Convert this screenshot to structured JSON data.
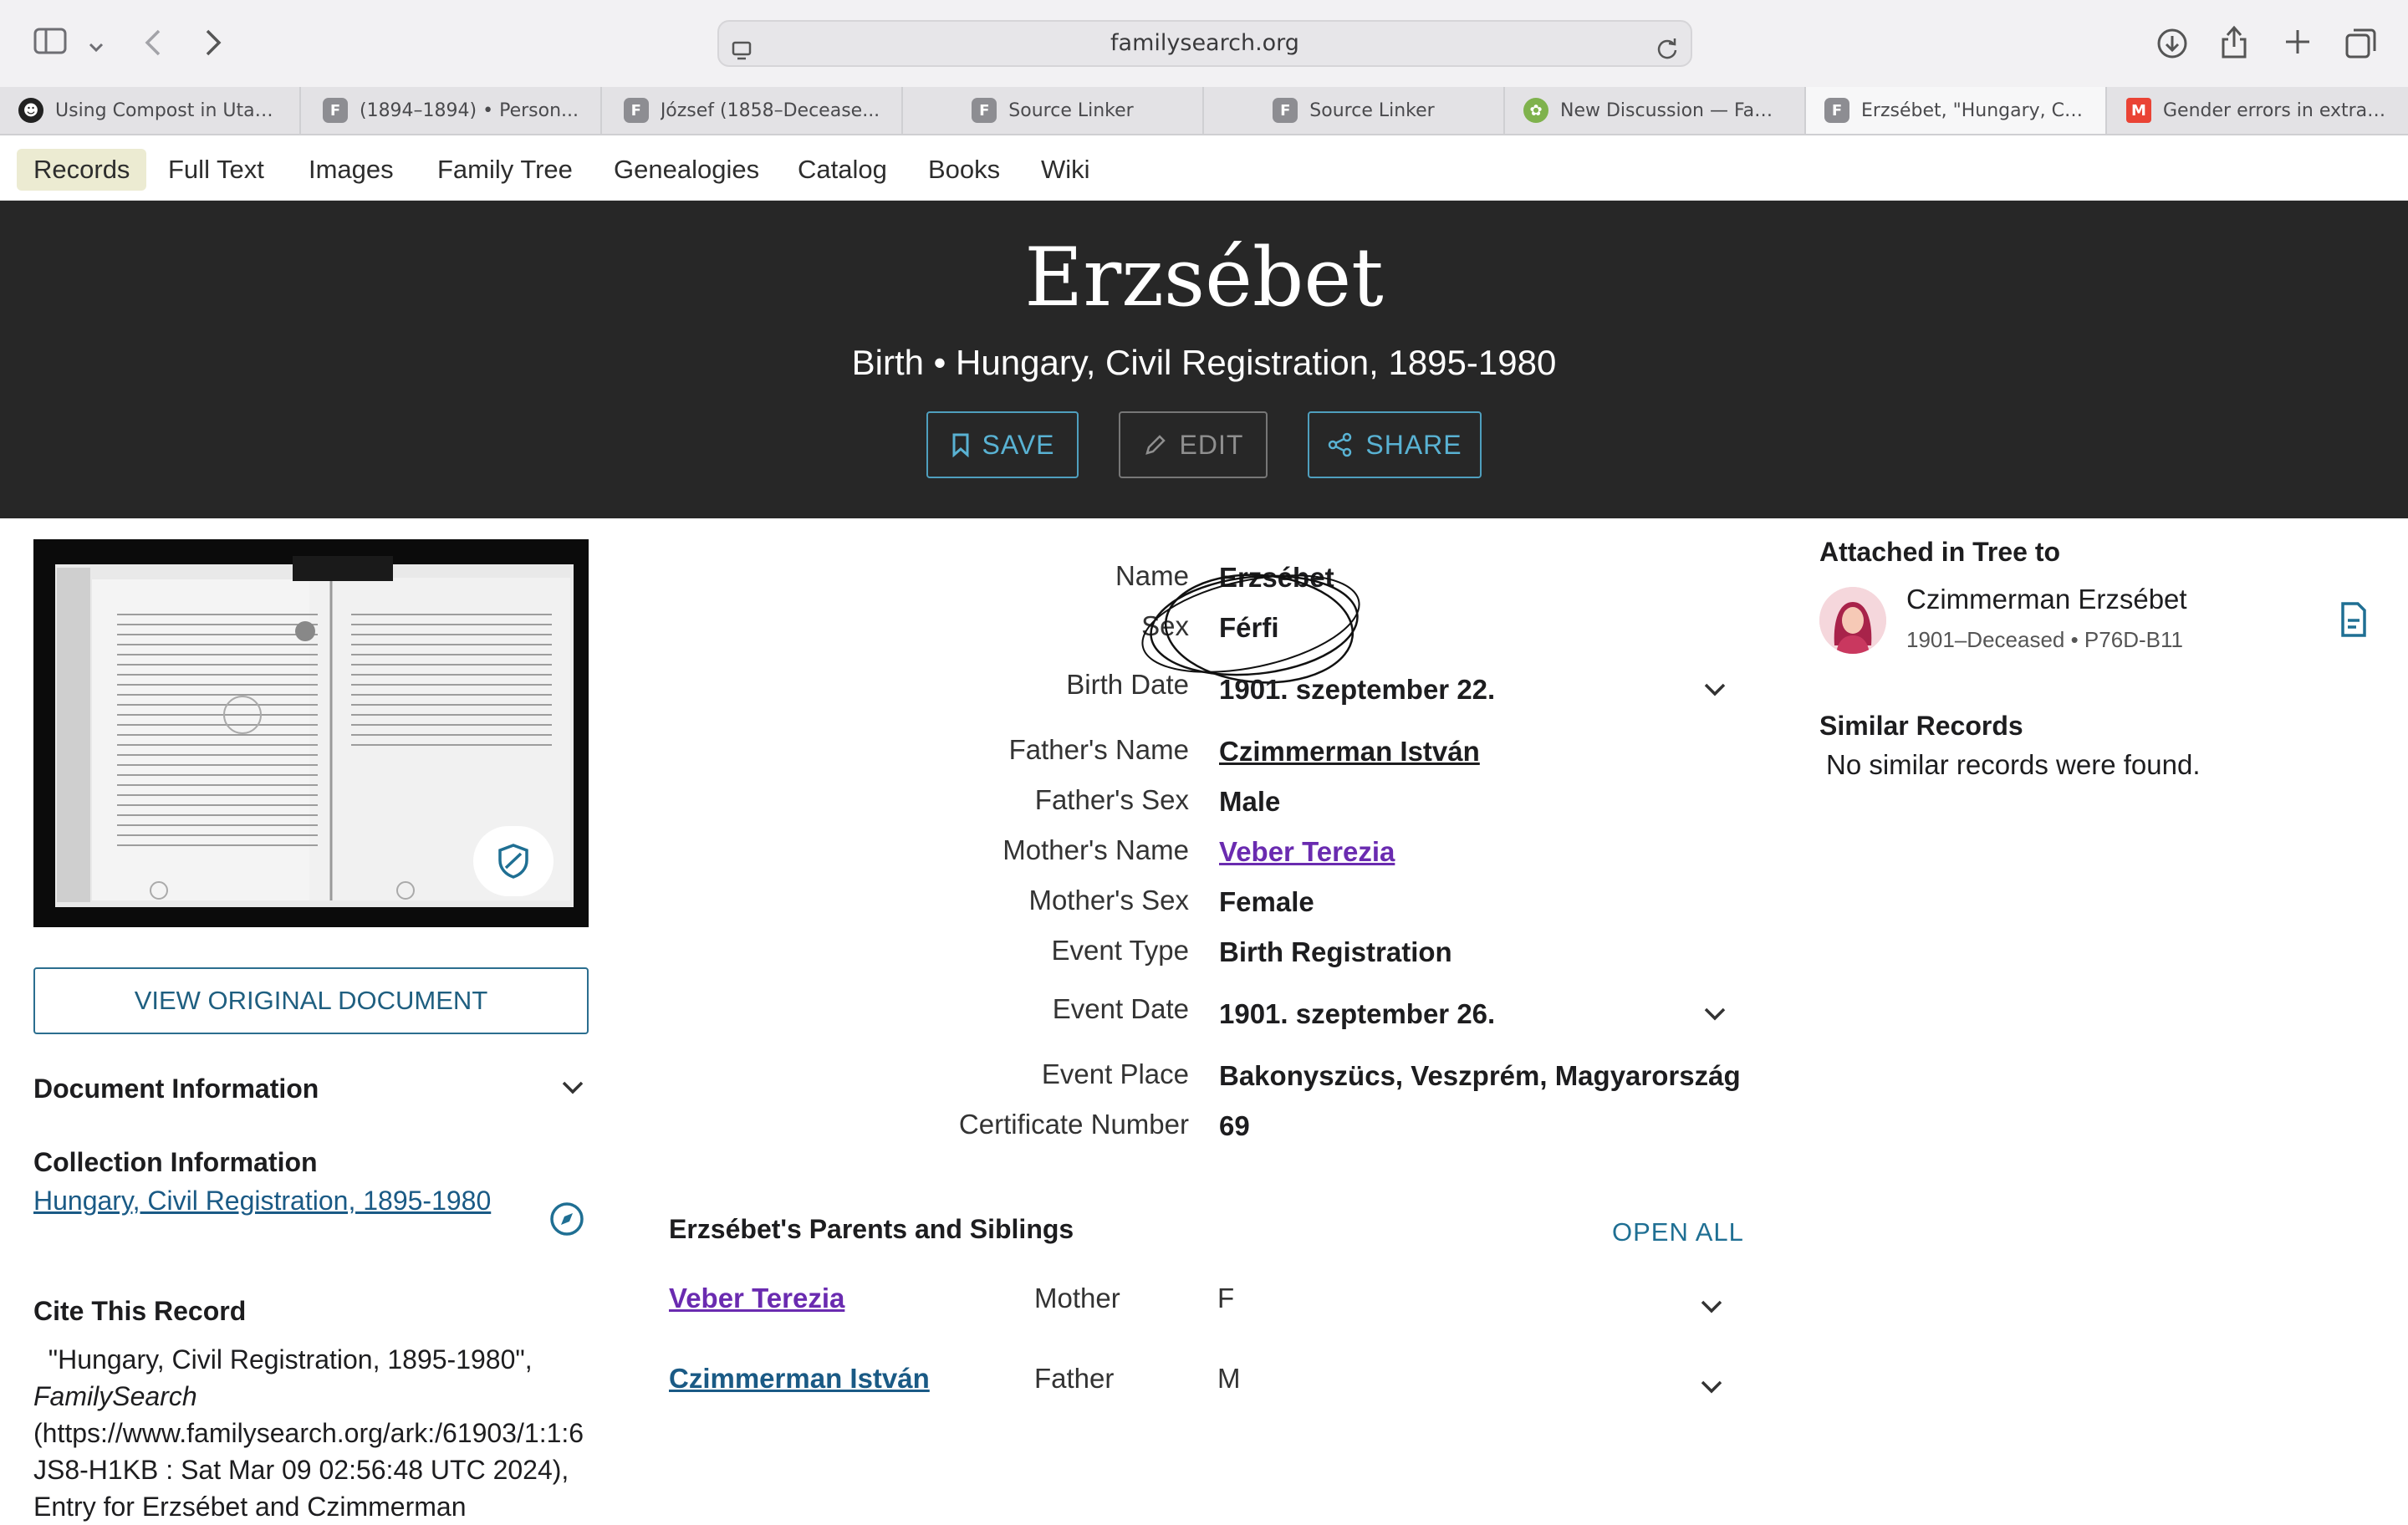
{
  "browser": {
    "url": "familysearch.org",
    "tabs": [
      {
        "label": "Using Compost in Utah...",
        "icon": "compost-favicon"
      },
      {
        "label": "(1894–1894) • Person...",
        "icon": "familysearch-favicon"
      },
      {
        "label": "József (1858–Decease...",
        "icon": "familysearch-favicon"
      },
      {
        "label": "Source Linker",
        "icon": "familysearch-favicon"
      },
      {
        "label": "Source Linker",
        "icon": "familysearch-favicon"
      },
      {
        "label": "New Discussion — Fam...",
        "icon": "tree-favicon"
      },
      {
        "label": "Erzsébet, \"Hungary, Ci...",
        "icon": "familysearch-favicon"
      },
      {
        "label": "Gender errors in extrac...",
        "icon": "gmail-favicon"
      }
    ]
  },
  "site_nav": [
    "Records",
    "Full Text",
    "Images",
    "Family Tree",
    "Genealogies",
    "Catalog",
    "Books",
    "Wiki"
  ],
  "hero": {
    "title": "Erzsébet",
    "subtitle": "Birth • Hungary, Civil Registration, 1895-1980",
    "save_label": "SAVE",
    "edit_label": "EDIT",
    "share_label": "SHARE"
  },
  "left": {
    "view_original": "VIEW ORIGINAL DOCUMENT",
    "doc_info_heading": "Document Information",
    "collection_heading": "Collection Information",
    "collection_link": "Hungary, Civil Registration, 1895-1980",
    "cite_heading": "Cite This Record",
    "cite_pre": "\"Hungary, Civil Registration, 1895-1980\",",
    "cite_italic": "FamilySearch",
    "cite_post": "(https://www.familysearch.org/ark:/61903/1:1:6JS8-H1KB : Sat Mar 09 02:56:48 UTC 2024), Entry for Erzsébet and Czimmerman"
  },
  "fields": [
    {
      "label": "Name",
      "value": "Erzsébet"
    },
    {
      "label": "Sex",
      "value": "Férfi"
    },
    {
      "label": "Birth Date",
      "value": "1901. szeptember 22."
    },
    {
      "label": "Father's Name",
      "value": "Czimmerman István"
    },
    {
      "label": "Father's Sex",
      "value": "Male"
    },
    {
      "label": "Mother's Name",
      "value": "Veber Terezia"
    },
    {
      "label": "Mother's Sex",
      "value": "Female"
    },
    {
      "label": "Event Type",
      "value": "Birth Registration"
    },
    {
      "label": "Event Date",
      "value": "1901. szeptember 26."
    },
    {
      "label": "Event Place",
      "value": "Bakonyszücs, Veszprém, Magyarország"
    },
    {
      "label": "Certificate Number",
      "value": "69"
    }
  ],
  "family": {
    "heading": "Erzsébet's Parents and Siblings",
    "open_all": "OPEN ALL",
    "members": [
      {
        "name": "Veber Terezia",
        "relation": "Mother",
        "sex": "F"
      },
      {
        "name": "Czimmerman István",
        "relation": "Father",
        "sex": "M"
      }
    ]
  },
  "right": {
    "attached_heading": "Attached in Tree to",
    "tree_person_name": "Czimmerman Erzsébet",
    "tree_person_meta": "1901–Deceased • P76D-B11",
    "similar_heading": "Similar Records",
    "similar_message": "No similar records were found."
  },
  "colors": {
    "hero_bg": "#272727",
    "accent_blue": "#59b2d3",
    "link": "#1a5a85",
    "visited_link": "#6a2bb0",
    "nav_active": "#ecebd2"
  }
}
